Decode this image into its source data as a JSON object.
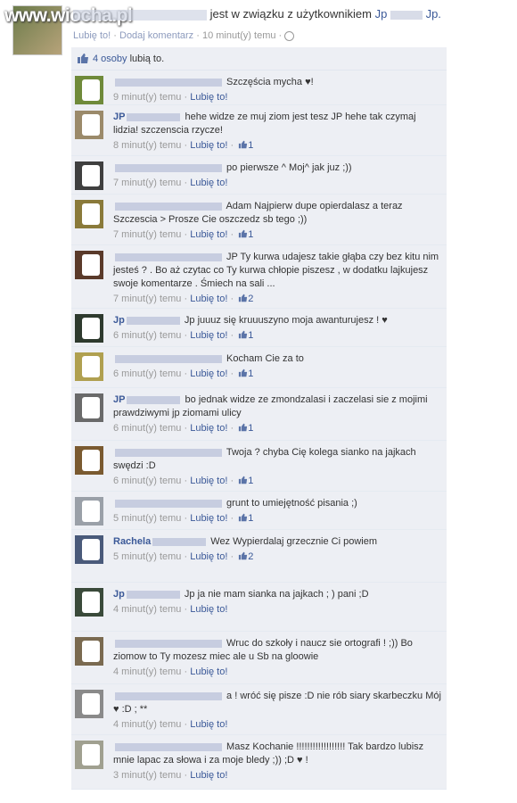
{
  "watermark": "www.wiocha.pl",
  "story": {
    "headline": "jest w związku z użytkownikiem",
    "partner": "Jp",
    "partner_tail": "Jp.",
    "like_link": "Lubię to!",
    "comment_link": "Dodaj komentarz",
    "time": "10 minut(y) temu",
    "sep": "·",
    "globe_icon": "globe-icon"
  },
  "likes": {
    "count": "4 osoby",
    "text": "lubią to.",
    "icon": "thumbs-up-icon"
  },
  "comment_ui": {
    "like_label": "Lubię to!",
    "sep": "·"
  },
  "comments": [
    {
      "author": "",
      "text": "Szczęścia mycha ♥!",
      "time": "9 minut(y) temu",
      "likes": "",
      "h": 38
    },
    {
      "author": "JP",
      "text": "hehe widze ze muj ziom jest tesz JP hehe tak czymaj lidzia! szczenscia rzycze!",
      "time": "8 minut(y) temu",
      "likes": "1",
      "h": 56
    },
    {
      "author": "",
      "text": "po pierwsze ^ Moj^ jak juz ;))",
      "time": "7 minut(y) temu",
      "likes": "",
      "h": 42
    },
    {
      "author": "",
      "text": "Adam Najpierw dupe opierdalasz a teraz Szczescia > Prosze Cie oszczedz sb tego ;))",
      "time": "7 minut(y) temu",
      "likes": "1",
      "h": 56
    },
    {
      "author": "",
      "text": "JP Ty kurwa udajesz takie głąba czy bez kitu nim jesteś ? . Bo aż czytac co Ty kurwa chłopie piszesz , w dodatku lajkujesz swoje komentarze . Śmiech na sali ...",
      "time": "7 minut(y) temu",
      "likes": "2",
      "h": 70
    },
    {
      "author": "Jp",
      "text": "Jp juuuz się kruuuszyno moja awanturujesz ! ♥",
      "time": "6 minut(y) temu",
      "likes": "1",
      "h": 42
    },
    {
      "author": "",
      "text": "Kocham Cie za to",
      "time": "6 minut(y) temu",
      "likes": "1",
      "h": 45
    },
    {
      "author": "JP",
      "text": "bo jednak widze ze zmondzalasi i zaczelasi sie z mojimi prawdziwymi jp ziomami ulicy",
      "time": "6 minut(y) temu",
      "likes": "1",
      "h": 58
    },
    {
      "author": "",
      "text": "Twoja ? chyba Cię kolega sianko na jajkach swędzi :D",
      "time": "6 minut(y) temu",
      "likes": "1",
      "h": 56
    },
    {
      "author": "",
      "text": "grunt to umiejętność pisania ;)",
      "time": "5 minut(y) temu",
      "likes": "1",
      "h": 42
    },
    {
      "author": "Rachela",
      "text": "Wez Wypierdalaj grzecznie Ci powiem",
      "time": "5 minut(y) temu",
      "likes": "2",
      "h": 58
    },
    {
      "author": "Jp",
      "text": "Jp ja nie mam sianka na jajkach ; ) pani ;D",
      "time": "4 minut(y) temu",
      "likes": "",
      "h": 54
    },
    {
      "author": "",
      "text": "Wruc do szkoły i naucz sie ortografi ! ;)) Bo ziomow to Ty mozesz miec ale u Sb na gloowie",
      "time": "4 minut(y) temu",
      "likes": "",
      "h": 58
    },
    {
      "author": "",
      "text": "a ! wróć się pisze :D nie rób siary skarbeczku Mój ♥ :D ; **",
      "time": "4 minut(y) temu",
      "likes": "",
      "h": 56
    },
    {
      "author": "",
      "text": "Masz Kochanie !!!!!!!!!!!!!!!!!! Tak bardzo lubisz mnie lapac za słowa i za moje bledy ;)) ;D ♥ !",
      "time": "3 minut(y) temu",
      "likes": "",
      "h": 60
    }
  ]
}
